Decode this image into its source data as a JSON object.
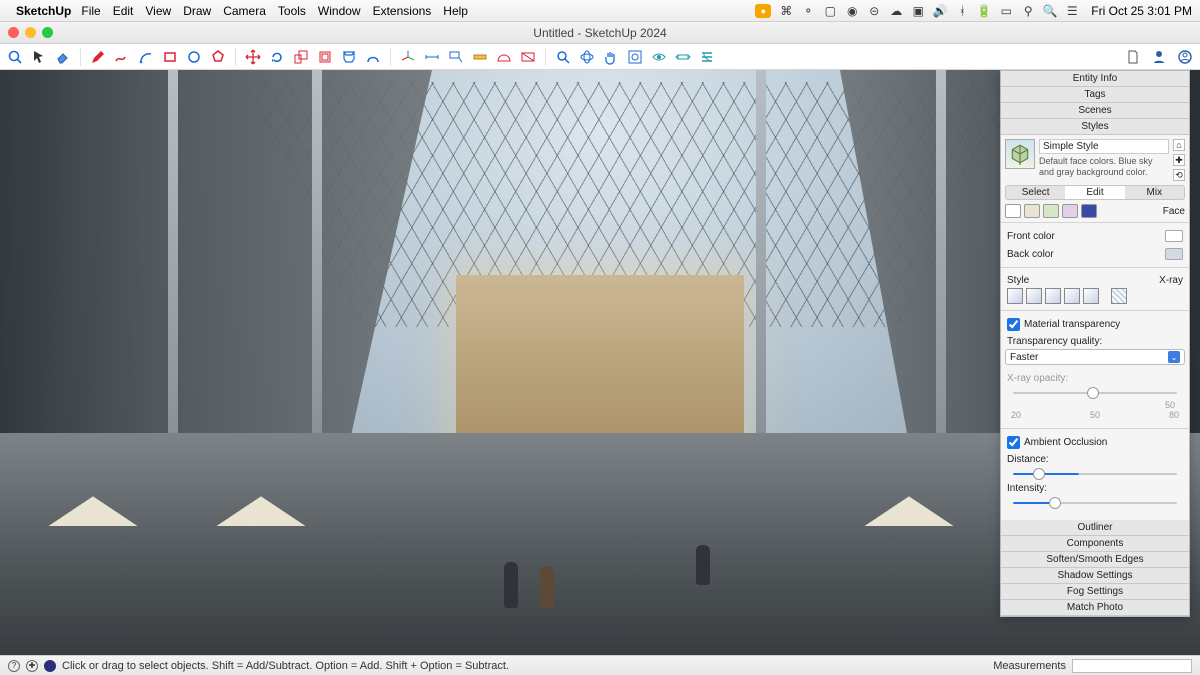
{
  "menubar": {
    "app_name": "SketchUp",
    "items": [
      "File",
      "Edit",
      "View",
      "Draw",
      "Camera",
      "Tools",
      "Window",
      "Extensions",
      "Help"
    ],
    "clock": "Fri Oct 25  3:01 PM"
  },
  "window": {
    "title": "Untitled - SketchUp 2024"
  },
  "toolbar_icons": [
    "search-icon",
    "select-arrow-icon",
    "eraser-icon",
    "pencil-icon",
    "freehand-icon",
    "arc-icon",
    "rectangle-icon",
    "circle-icon",
    "polygon-icon",
    "move-icon",
    "rotate-icon",
    "scale-icon",
    "offset-icon",
    "pushpull-icon",
    "followme-icon",
    "axes-icon",
    "dimension-icon",
    "text-icon",
    "tape-icon",
    "protractor-icon",
    "section-icon",
    "zoom-icon",
    "orbit-icon",
    "pan-icon",
    "zoom-extents-icon",
    "position-camera-icon",
    "look-around-icon",
    "walk-icon"
  ],
  "toolbar_right_icons": [
    "new-doc-icon",
    "user-icon",
    "account-icon"
  ],
  "panel": {
    "sections": {
      "entity_info": "Entity Info",
      "tags": "Tags",
      "scenes": "Scenes",
      "styles": "Styles",
      "outliner": "Outliner",
      "components": "Components",
      "soften": "Soften/Smooth Edges",
      "shadow": "Shadow Settings",
      "fog": "Fog Settings",
      "match": "Match Photo"
    },
    "style": {
      "name": "Simple Style",
      "description": "Default face colors. Blue sky and gray background color.",
      "tabs": {
        "select": "Select",
        "edit": "Edit",
        "mix": "Mix"
      },
      "face_label": "Face",
      "front_color": "Front color",
      "back_color": "Back color",
      "style_label": "Style",
      "xray_label": "X-ray",
      "material_transparency": "Material transparency",
      "transparency_quality_label": "Transparency quality:",
      "transparency_quality_value": "Faster",
      "xray_opacity_label": "X-ray opacity:",
      "xray_ticks": {
        "a": "20",
        "b": "50",
        "c": "80",
        "val": "50"
      },
      "ambient_occlusion": "Ambient Occlusion",
      "distance": "Distance:",
      "intensity": "Intensity:"
    }
  },
  "statusbar": {
    "hint": "Click or drag to select objects. Shift = Add/Subtract. Option = Add. Shift + Option = Subtract.",
    "measurements": "Measurements"
  }
}
